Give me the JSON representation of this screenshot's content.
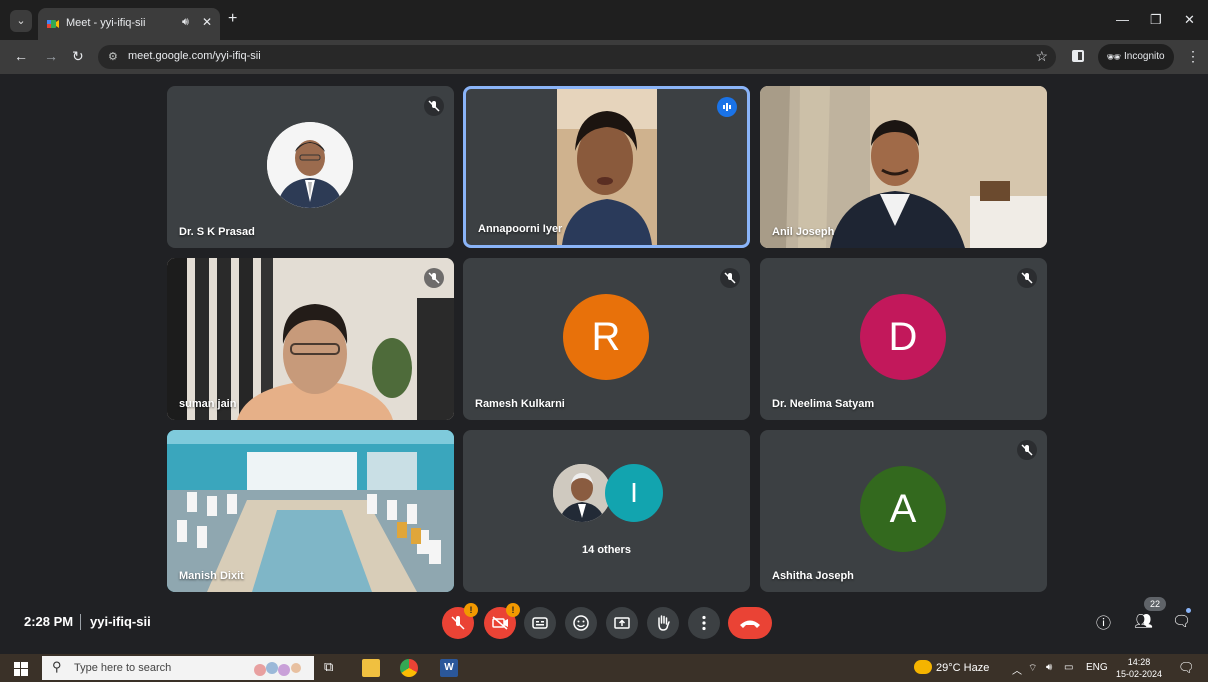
{
  "browser": {
    "tab_title": "Meet - yyi-ifiq-sii",
    "tab_audio_icon": "speaker-icon",
    "url": "meet.google.com/yyi-ifiq-sii",
    "incognito_label": "Incognito"
  },
  "tiles": [
    {
      "name": "Dr. S K Prasad",
      "muted": true
    },
    {
      "name": "Annapoorni Iyer",
      "speaking": true
    },
    {
      "name": "Anil Joseph"
    },
    {
      "name": "suman jain",
      "muted": true
    },
    {
      "name": "Ramesh Kulkarni",
      "initial": "R",
      "color": "#e8710a",
      "muted": true
    },
    {
      "name": "Dr. Neelima Satyam",
      "initial": "D",
      "color": "#c2185b",
      "muted": true
    },
    {
      "name": "Manish Dixit"
    },
    {
      "others_label": "14 others",
      "initial": "I",
      "color": "#12a4af"
    },
    {
      "name": "Ashitha Joseph",
      "initial": "A",
      "color": "#33691e",
      "muted": true
    }
  ],
  "meeting": {
    "time": "2:28 PM",
    "code": "yyi-ifiq-sii",
    "participants_count": "22",
    "warn_mark": "!"
  },
  "taskbar": {
    "search_placeholder": "Type here to search",
    "weather": "29°C  Haze",
    "lang": "ENG",
    "clock_time": "14:28",
    "clock_date": "15-02-2024"
  }
}
